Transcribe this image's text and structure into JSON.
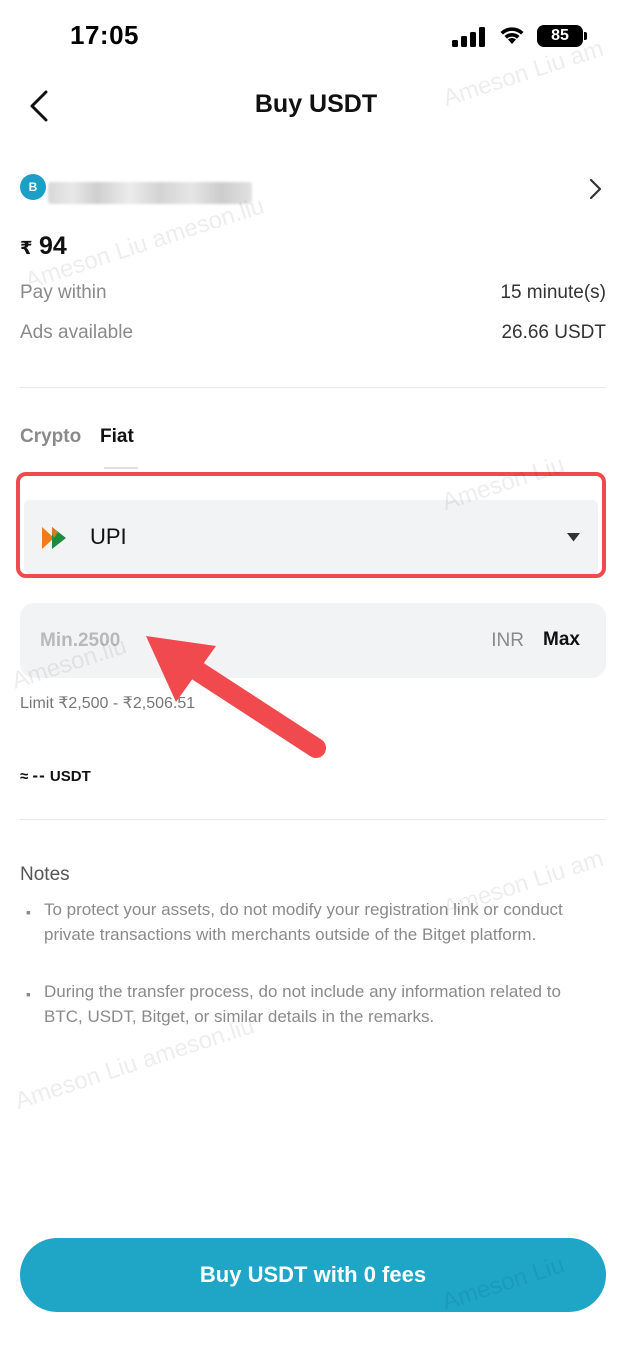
{
  "status_bar": {
    "time": "17:05",
    "battery": "85"
  },
  "header": {
    "title": "Buy USDT"
  },
  "merchant": {
    "avatar_letter": "B"
  },
  "price": {
    "currency": "₹",
    "value": "94"
  },
  "info": [
    {
      "label": "Pay within",
      "value": "15 minute(s)"
    },
    {
      "label": "Ads available",
      "value": "26.66 USDT"
    }
  ],
  "tabs": [
    {
      "label": "Crypto",
      "active": false
    },
    {
      "label": "Fiat",
      "active": true
    }
  ],
  "payment": {
    "method": "UPI",
    "icon": "upi-icon"
  },
  "amount": {
    "placeholder": "Min.2500",
    "currency": "INR",
    "max_label": "Max",
    "limit": "Limit ₹2,500 - ₹2,506.51"
  },
  "estimate": {
    "prefix": "≈",
    "value": "--",
    "unit": "USDT"
  },
  "notes": {
    "title": "Notes",
    "items": [
      "To protect your assets, do not modify your registration link or conduct private transactions with merchants outside of the Bitget platform.",
      "During the transfer process, do not include any information related to BTC, USDT, Bitget, or similar details in the remarks."
    ]
  },
  "buy_button": {
    "label": "Buy USDT with 0 fees"
  },
  "watermarks": [
    "Ameson Liu am",
    "Ameson Liu ameson.liu",
    "Ameson Liu",
    "Ameson.liu",
    "Ameson Liu am",
    "Ameson Liu ameson.liu",
    "Ameson Liu"
  ],
  "colors": {
    "accent": "#1fa6c7",
    "highlight": "#f04a4f",
    "field_bg": "#f2f3f5"
  }
}
